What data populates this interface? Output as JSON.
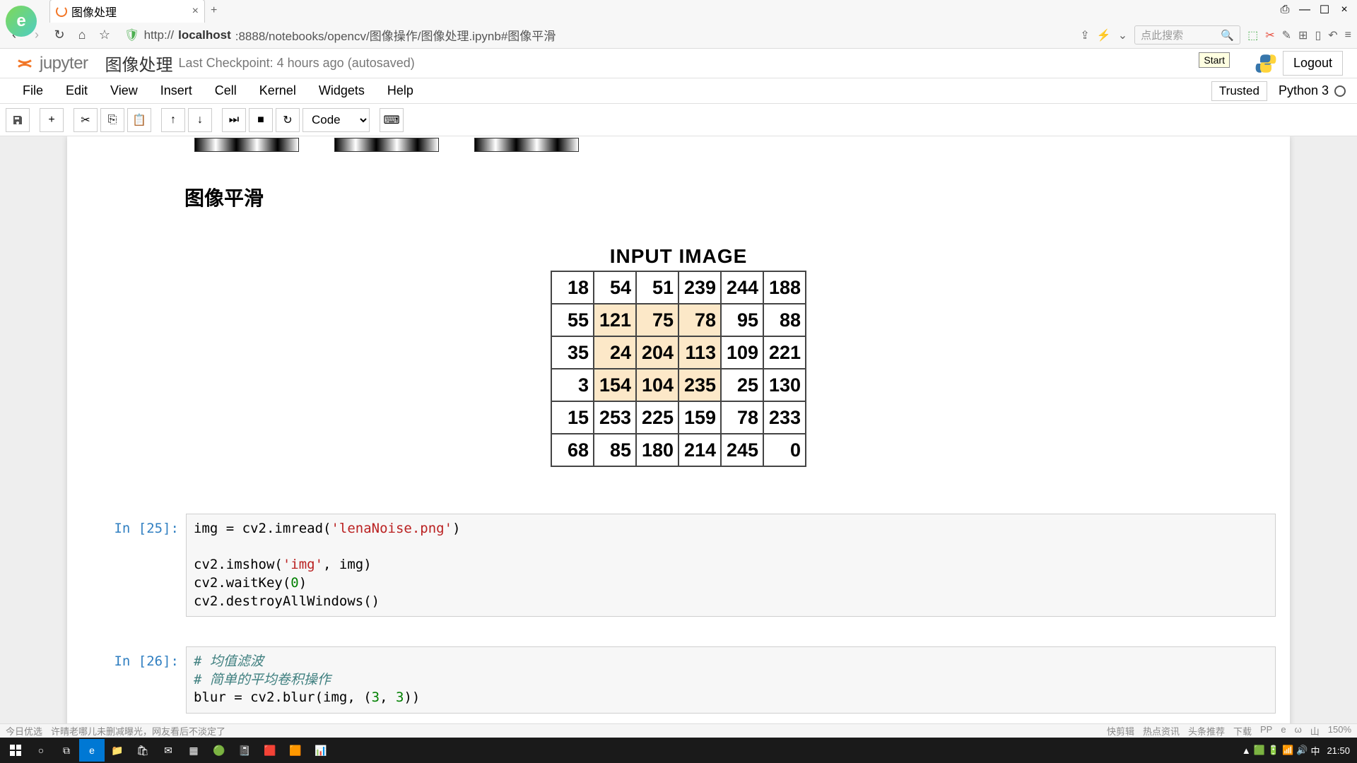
{
  "browser": {
    "tab_title": "图像处理",
    "url_prefix": "http://",
    "url_host": "localhost",
    "url_path": ":8888/notebooks/opencv/图像操作/图像处理.ipynb#图像平滑",
    "search_placeholder": "点此搜索",
    "start_tooltip": "Start"
  },
  "jupyter": {
    "logo_text": "jupyter",
    "notebook_name": "图像处理",
    "checkpoint": "Last Checkpoint: 4 hours ago (autosaved)",
    "logout": "Logout",
    "trusted": "Trusted",
    "kernel": "Python 3",
    "menu": [
      "File",
      "Edit",
      "View",
      "Insert",
      "Cell",
      "Kernel",
      "Widgets",
      "Help"
    ],
    "celltype": "Code"
  },
  "content": {
    "heading": "图像平滑",
    "matrix_title": "INPUT IMAGE",
    "matrix": [
      [
        18,
        54,
        51,
        239,
        244,
        188
      ],
      [
        55,
        121,
        75,
        78,
        95,
        88
      ],
      [
        35,
        24,
        204,
        113,
        109,
        221
      ],
      [
        3,
        154,
        104,
        235,
        25,
        130
      ],
      [
        15,
        253,
        225,
        159,
        78,
        233
      ],
      [
        68,
        85,
        180,
        214,
        245,
        0
      ]
    ],
    "highlight_rows": [
      1,
      2,
      3
    ],
    "highlight_cols": [
      1,
      2,
      3
    ],
    "cells": [
      {
        "prompt": "In [25]:",
        "code_html": "img = cv2.imread(<span class='cm-str'>'lenaNoise.png'</span>)\n\ncv2.imshow(<span class='cm-str'>'img'</span>, img)\ncv2.waitKey(<span class='cm-num'>0</span>)\ncv2.destroyAllWindows()"
      },
      {
        "prompt": "In [26]:",
        "code_html": "<span class='cm-comment'># 均值滤波</span>\n<span class='cm-comment'># 简单的平均卷积操作</span>\nblur = cv2.blur(img, (<span class='cm-num'>3</span>, <span class='cm-num'>3</span>))"
      }
    ]
  },
  "status": {
    "left1": "今日优选",
    "left2": "许晴老哪儿未删减曝光，网友看后不淡定了",
    "right": [
      "快剪辑",
      "热点资讯",
      "头条推荐",
      "下载",
      "PP",
      "e",
      "ω",
      "山",
      "150%"
    ]
  },
  "taskbar": {
    "time": "21:50",
    "date": ""
  }
}
